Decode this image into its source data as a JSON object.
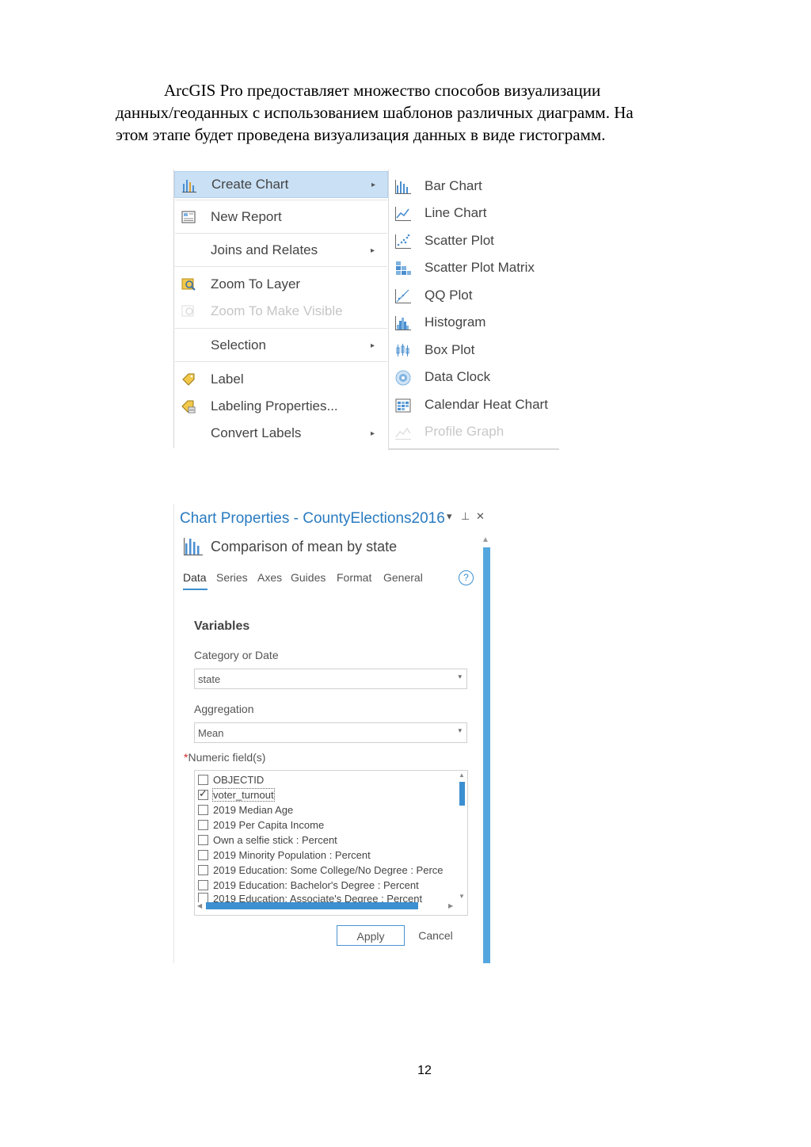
{
  "paragraph": {
    "line1": "ArcGIS Pro предоставляет множество способов визуализации",
    "line2": "данных/геоданных с использованием шаблонов различных диаграмм. На",
    "line3": "этом этапе будет проведена визуализация данных в виде гистограмм."
  },
  "context_menu": {
    "items": [
      {
        "label": "Create Chart",
        "icon": "bar-chart-icon",
        "submenu": true,
        "highlighted": true
      },
      {
        "label": "New Report",
        "icon": "report-icon"
      },
      {
        "label": "Joins and Relates",
        "submenu": true
      },
      {
        "label": "Zoom To Layer",
        "icon": "zoom-layer-icon"
      },
      {
        "label": "Zoom To Make Visible",
        "icon": "zoom-visible-icon",
        "disabled": true
      },
      {
        "label": "Selection",
        "submenu": true
      },
      {
        "label": "Label",
        "icon": "label-icon"
      },
      {
        "label": "Labeling Properties...",
        "icon": "labeling-properties-icon"
      },
      {
        "label": "Convert Labels",
        "submenu": true
      }
    ],
    "submenu_arrow": "▸"
  },
  "chart_submenu": {
    "items": [
      {
        "label": "Bar Chart",
        "icon": "bar-chart-icon"
      },
      {
        "label": "Line Chart",
        "icon": "line-chart-icon"
      },
      {
        "label": "Scatter Plot",
        "icon": "scatter-plot-icon"
      },
      {
        "label": "Scatter Plot Matrix",
        "icon": "scatter-matrix-icon"
      },
      {
        "label": "QQ Plot",
        "icon": "qq-plot-icon"
      },
      {
        "label": "Histogram",
        "icon": "histogram-icon"
      },
      {
        "label": "Box Plot",
        "icon": "box-plot-icon"
      },
      {
        "label": "Data Clock",
        "icon": "data-clock-icon"
      },
      {
        "label": "Calendar Heat Chart",
        "icon": "calendar-heat-icon"
      },
      {
        "label": "Profile Graph",
        "icon": "profile-graph-icon",
        "disabled": true
      }
    ]
  },
  "chart_properties": {
    "title": "Chart Properties - CountyElections2016",
    "controls": {
      "menu": "▾",
      "pin": "⊥",
      "close": "✕"
    },
    "chart_name": "Comparison of mean  by state",
    "tabs": [
      "Data",
      "Series",
      "Axes",
      "Guides",
      "Format",
      "General"
    ],
    "active_tab": "Data",
    "help": "?",
    "section": "Variables",
    "category_label": "Category or Date",
    "category_value": "state",
    "aggregation_label": "Aggregation",
    "aggregation_value": "Mean",
    "numeric_label": "Numeric field(s)",
    "required_mark": "*",
    "fields": [
      {
        "name": "OBJECTID",
        "checked": false
      },
      {
        "name": "voter_turnout",
        "checked": true
      },
      {
        "name": "2019 Median Age",
        "checked": false
      },
      {
        "name": "2019 Per Capita Income",
        "checked": false
      },
      {
        "name": "Own a selfie stick : Percent",
        "checked": false
      },
      {
        "name": "2019 Minority Population : Percent",
        "checked": false
      },
      {
        "name": "2019 Education: Some College/No Degree : Perce",
        "checked": false
      },
      {
        "name": "2019 Education: Bachelor's Degree : Percent",
        "checked": false
      },
      {
        "name": "2019 Education: Associate's Degree : Percent",
        "checked": false
      }
    ],
    "apply_label": "Apply",
    "cancel_label": "Cancel",
    "accent_color": "#3c8fd0"
  },
  "page_number": "12"
}
